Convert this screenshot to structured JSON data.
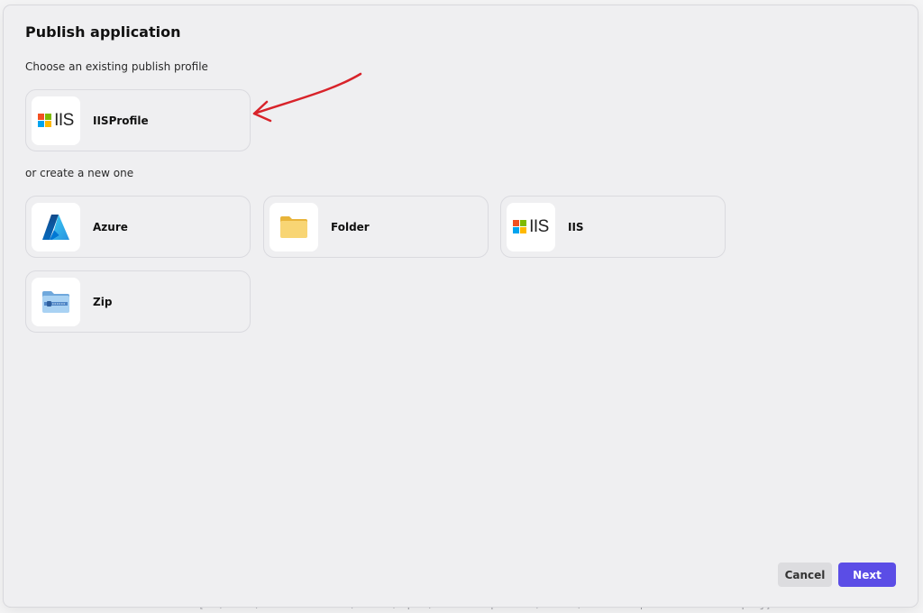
{
  "dialog": {
    "title": "Publish application",
    "existing_label": "Choose an existing publish profile",
    "new_label": "or create a new one"
  },
  "existing_profiles": [
    {
      "label": "IISProfile",
      "icon": "iis-logo-icon"
    }
  ],
  "new_targets": [
    {
      "label": "Azure",
      "icon": "azure-logo-icon"
    },
    {
      "label": "Folder",
      "icon": "folder-icon"
    },
    {
      "label": "IIS",
      "icon": "iis-logo-icon"
    },
    {
      "label": "Zip",
      "icon": "zip-folder-icon"
    }
  ],
  "buttons": {
    "cancel": "Cancel",
    "next": "Next"
  },
  "iis_logo_text": "IIS",
  "background": {
    "bottom_line": "Conectar con el servidor remoto [C:\\Users\\PORTLAND STUDIO\\source\\repos\\AuxiliarEmpleados\\Server\\AuxiliarEmpleados.Server.csproj]"
  },
  "colors": {
    "accent": "#5b4de6",
    "annotation_arrow": "#d8232a",
    "ms_red": "#f25022",
    "ms_green": "#7fba00",
    "ms_blue": "#00a4ef",
    "ms_yellow": "#ffb900"
  }
}
